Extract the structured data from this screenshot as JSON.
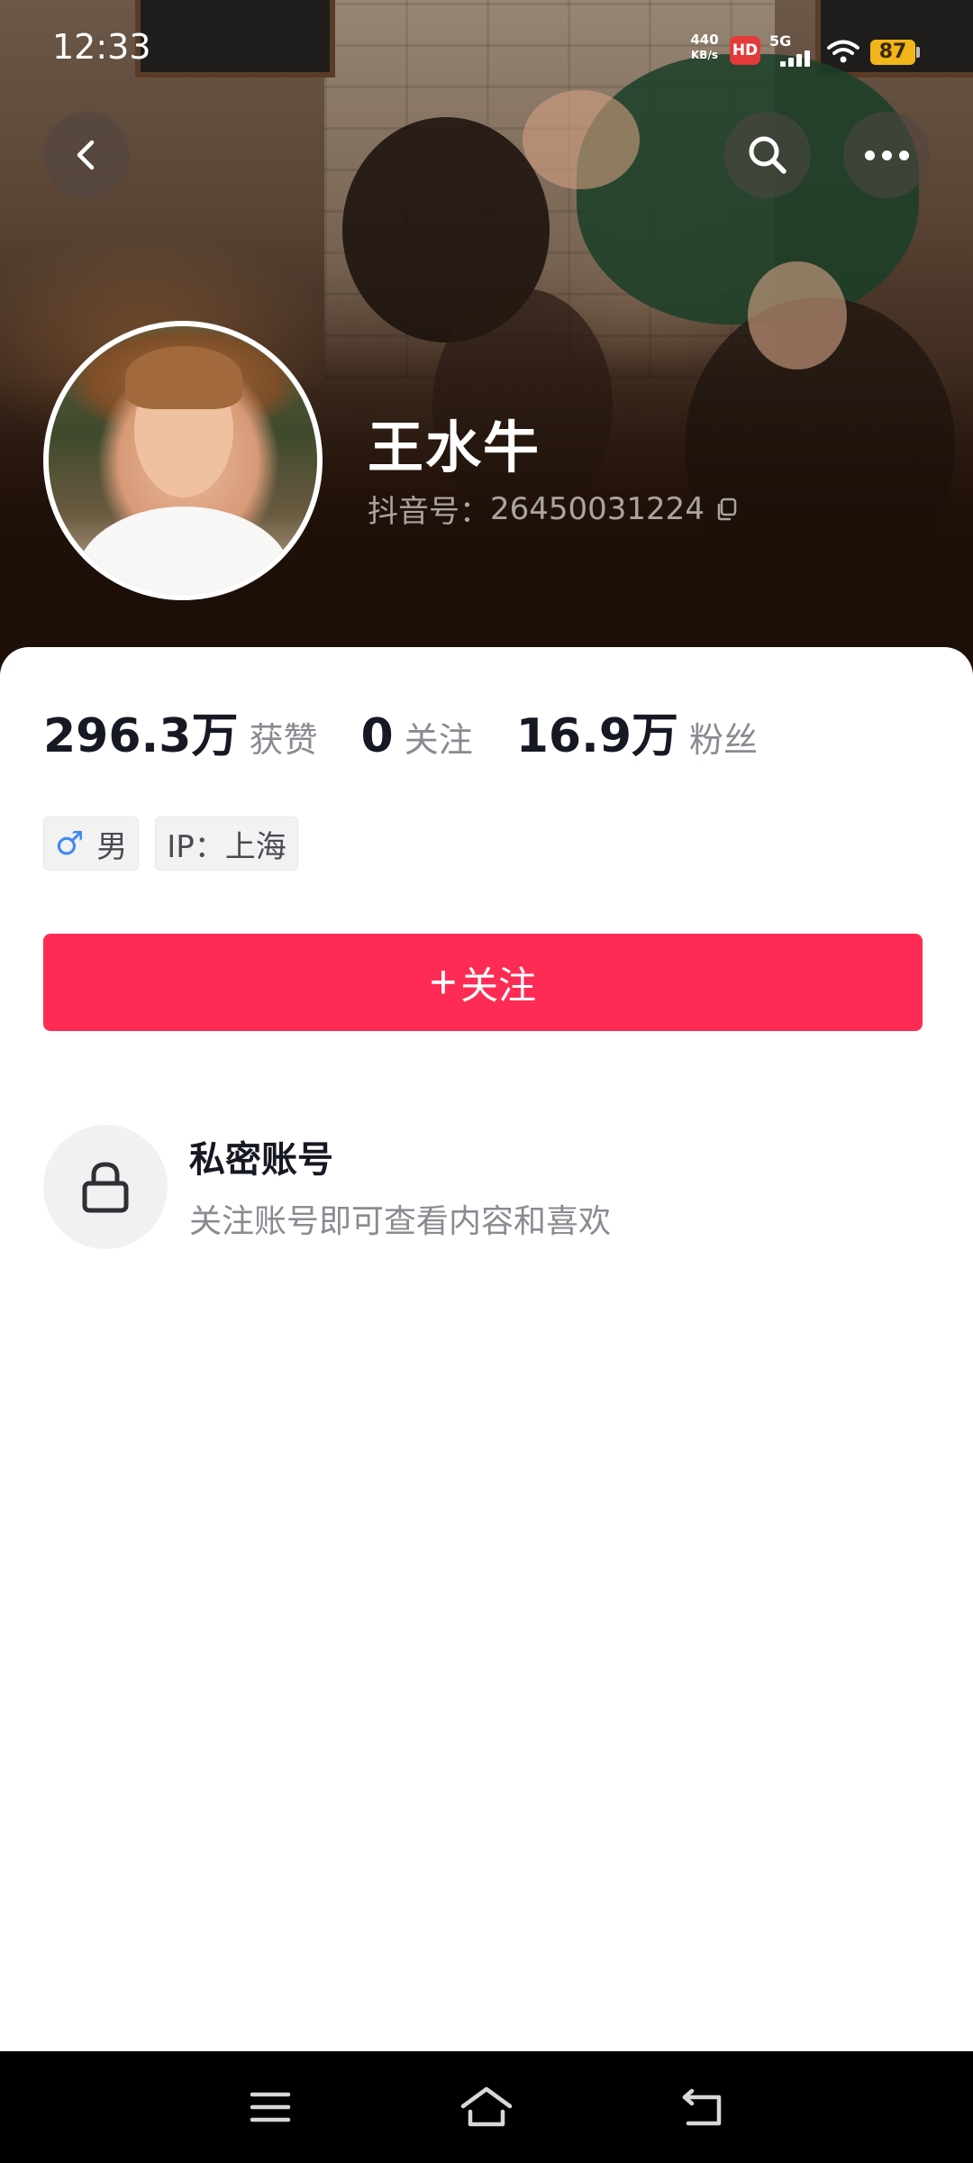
{
  "status_bar": {
    "time": "12:33",
    "net_speed_value": "440",
    "net_speed_unit": "KB/s",
    "hd_badge": "HD",
    "network_type": "5G",
    "battery_level": "87"
  },
  "header": {
    "back_icon": "chevron-left-icon",
    "search_icon": "search-icon",
    "more_icon": "more-horizontal-icon"
  },
  "profile": {
    "name": "王水牛",
    "douyin_id_label": "抖音号：",
    "douyin_id": "26450031224"
  },
  "stats": [
    {
      "value": "296.3万",
      "label": "获赞"
    },
    {
      "value": "0",
      "label": "关注"
    },
    {
      "value": "16.9万",
      "label": "粉丝"
    }
  ],
  "tags": {
    "gender_symbol": "♂",
    "gender": "男",
    "ip": "IP：上海"
  },
  "follow_button": {
    "plus": "+",
    "label": "关注"
  },
  "private_account": {
    "title": "私密账号",
    "description": "关注账号即可查看内容和喜欢"
  },
  "colors": {
    "accent": "#fe2c55",
    "battery": "#f2b61a",
    "gender_icon": "#3d8bf2"
  }
}
